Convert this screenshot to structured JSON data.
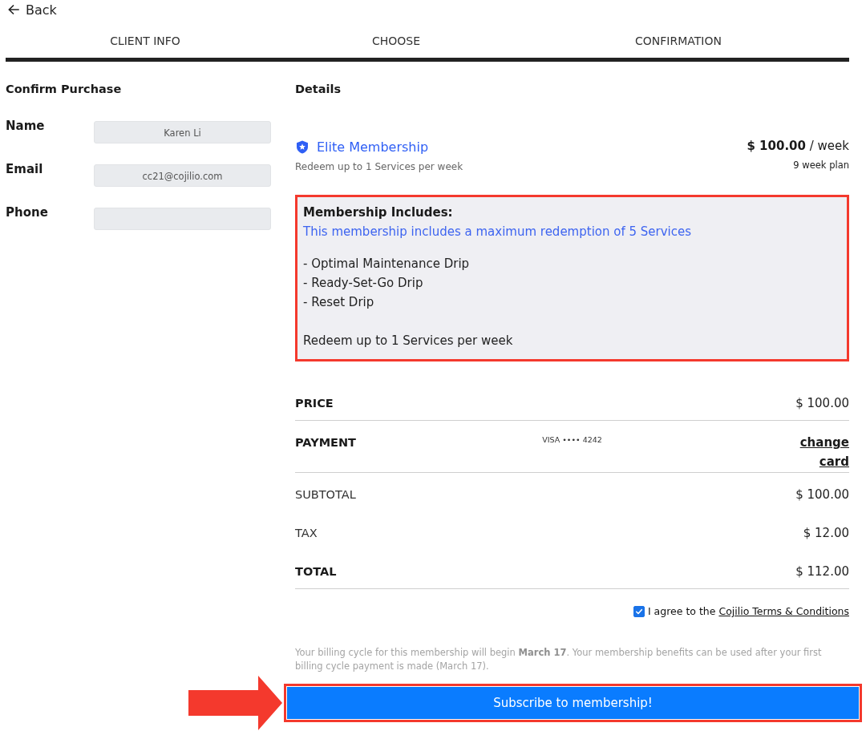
{
  "back": {
    "label": "Back"
  },
  "steps": [
    {
      "label": "CLIENT INFO"
    },
    {
      "label": "CHOOSE"
    },
    {
      "label": "CONFIRMATION"
    }
  ],
  "progress": {
    "level": 1
  },
  "client": {
    "title": "Confirm Purchase",
    "fields": [
      {
        "label": "Name",
        "value": "Karen Li"
      },
      {
        "label": "Email",
        "value": "cc21@cojilio.com"
      },
      {
        "label": "Phone"
      }
    ]
  },
  "details": {
    "title": "Details",
    "plan": {
      "name": "Elite Membership",
      "subtitle": "Redeem up to 1 Services per week",
      "price": "**$ 100.00** / week",
      "term": "9 week plan"
    },
    "includes": {
      "highlighted": true,
      "title": "Membership Includes:",
      "summary": "This membership includes a maximum redemption of 5 Services",
      "items": [
        "- Optimal Maintenance Drip",
        "- Ready-Set-Go Drip",
        "- Reset Drip"
      ],
      "footer": "Redeem up to 1 Services per week"
    }
  },
  "summary": [
    {
      "kind": "amount",
      "label": "PRICE",
      "value": "$ 100.00",
      "bold": true,
      "divider": true
    },
    {
      "kind": "payment",
      "label": "PAYMENT",
      "card": "VISA •••• 4242",
      "action": "change card",
      "bold": true,
      "divider": true
    },
    {
      "kind": "amount",
      "label": "SUBTOTAL",
      "value": "$ 100.00",
      "bold": false,
      "divider": false
    },
    {
      "kind": "amount",
      "label": "TAX",
      "value": "$ 12.00",
      "bold": false,
      "divider": false
    },
    {
      "kind": "amount",
      "label": "TOTAL",
      "value": "$ 112.00",
      "bold": true,
      "divider": true
    }
  ],
  "agreement": {
    "checked": true,
    "text": "I agree to the",
    "link": "Cojilio Terms & Conditions"
  },
  "billing_note": "Your billing cycle for this membership will begin **March 17**. Your membership benefits can be used after your first billing cycle payment is made (March 17).",
  "subscribe": {
    "label": "Subscribe to membership!",
    "highlighted": true,
    "pointer_arrow": true
  }
}
